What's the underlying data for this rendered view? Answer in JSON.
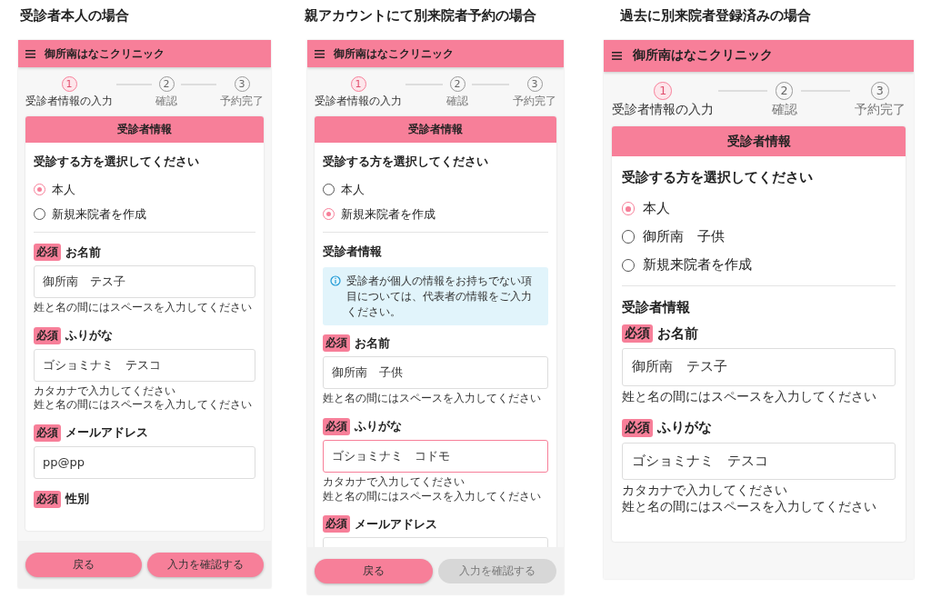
{
  "columns": [
    {
      "caption": "受診者本人の場合",
      "phone": {
        "title": "御所南はなこクリニック",
        "steps": [
          {
            "number": "1",
            "label": "受診者情報の入力",
            "active": true
          },
          {
            "number": "2",
            "label": "確認",
            "active": false
          },
          {
            "number": "3",
            "label": "予約完了",
            "active": false
          }
        ],
        "card_title": "受診者情報",
        "question": "受診する方を選択してください",
        "options": [
          {
            "label": "本人",
            "selected": true
          },
          {
            "label": "新規来院者を作成",
            "selected": false
          }
        ],
        "fields": [
          {
            "badge": "必須",
            "label": "お名前",
            "value": "御所南　テス子",
            "focused": false,
            "hints": [
              "姓と名の間にはスペースを入力してください"
            ]
          },
          {
            "badge": "必須",
            "label": "ふりがな",
            "value": "ゴショミナミ　テスコ",
            "focused": false,
            "hints": [
              "カタカナで入力してください",
              "姓と名の間にはスペースを入力してください"
            ]
          },
          {
            "badge": "必須",
            "label": "メールアドレス",
            "value": "pp@pp",
            "focused": false
          },
          {
            "badge": "必須",
            "label": "性別"
          }
        ],
        "buttons": [
          {
            "label": "戻る",
            "disabled": false
          },
          {
            "label": "入力を確認する",
            "disabled": false
          }
        ]
      }
    },
    {
      "caption": "親アカウントにて別来院者予約の場合",
      "phone": {
        "title": "御所南はなこクリニック",
        "steps": [
          {
            "number": "1",
            "label": "受診者情報の入力",
            "active": true
          },
          {
            "number": "2",
            "label": "確認",
            "active": false
          },
          {
            "number": "3",
            "label": "予約完了",
            "active": false
          }
        ],
        "card_title": "受診者情報",
        "question": "受診する方を選択してください",
        "options": [
          {
            "label": "本人",
            "selected": false
          },
          {
            "label": "新規来院者を作成",
            "selected": true
          }
        ],
        "section_heading": "受診者情報",
        "info": "受診者が個人の情報をお持ちでない項目については、代表者の情報をご入力ください。",
        "fields": [
          {
            "badge": "必須",
            "label": "お名前",
            "value": "御所南　子供",
            "focused": false,
            "hints": [
              "姓と名の間にはスペースを入力してください"
            ]
          },
          {
            "badge": "必須",
            "label": "ふりがな",
            "value": "ゴショミナミ　コドモ",
            "focused": true,
            "hints": [
              "カタカナで入力してください",
              "姓と名の間にはスペースを入力してください"
            ]
          },
          {
            "badge": "必須",
            "label": "メールアドレス",
            "focused": false
          }
        ],
        "buttons": [
          {
            "label": "戻る",
            "disabled": false
          },
          {
            "label": "入力を確認する",
            "disabled": true
          }
        ]
      }
    },
    {
      "caption": "過去に別来院者登録済みの場合",
      "phone": {
        "title": "御所南はなこクリニック",
        "steps": [
          {
            "number": "1",
            "label": "受診者情報の入力",
            "active": true
          },
          {
            "number": "2",
            "label": "確認",
            "active": false
          },
          {
            "number": "3",
            "label": "予約完了",
            "active": false
          }
        ],
        "card_title": "受診者情報",
        "question": "受診する方を選択してください",
        "options": [
          {
            "label": "本人",
            "selected": true
          },
          {
            "label": "御所南　子供",
            "selected": false
          },
          {
            "label": "新規来院者を作成",
            "selected": false
          }
        ],
        "section_heading": "受診者情報",
        "fields": [
          {
            "badge": "必須",
            "label": "お名前",
            "value": "御所南　テス子",
            "focused": false,
            "hints": [
              "姓と名の間にはスペースを入力してください"
            ]
          },
          {
            "badge": "必須",
            "label": "ふりがな",
            "value": "ゴショミナミ　テスコ",
            "focused": false,
            "hints": [
              "カタカナで入力してください",
              "姓と名の間にはスペースを入力してください"
            ]
          }
        ]
      }
    }
  ]
}
